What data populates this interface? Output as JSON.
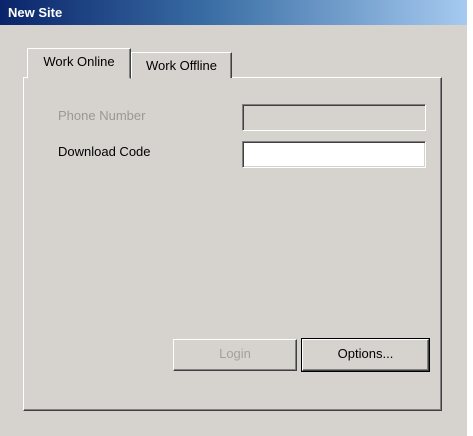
{
  "window": {
    "title": "New Site"
  },
  "tabs": [
    {
      "label": "Work Online",
      "selected": true
    },
    {
      "label": "Work Offline",
      "selected": false
    }
  ],
  "form": {
    "phone_label": "Phone Number",
    "phone_value": "",
    "phone_enabled": false,
    "download_label": "Download Code",
    "download_value": ""
  },
  "buttons": {
    "login_label": "Login",
    "login_enabled": false,
    "options_label": "Options..."
  },
  "colors": {
    "face": "#d6d3ce",
    "title_start": "#0a246a",
    "title_end": "#a6caf0",
    "disabled_text": "#9a9893"
  }
}
